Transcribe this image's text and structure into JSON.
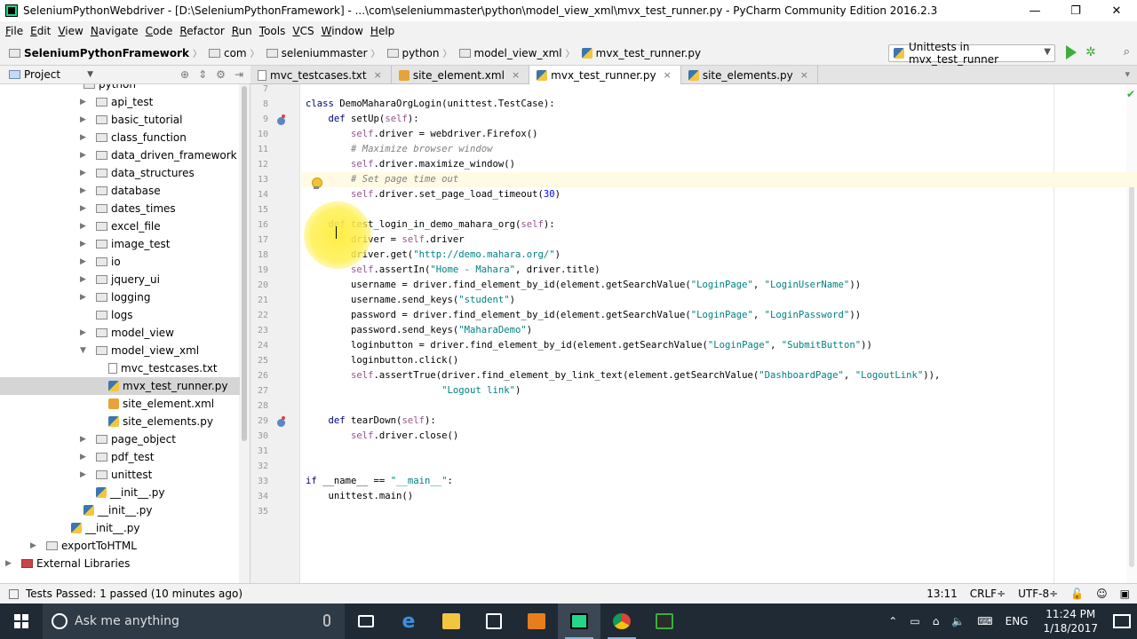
{
  "window": {
    "title": "SeleniumPythonWebdriver - [D:\\SeleniumPythonFramework] - ...\\com\\seleniummaster\\python\\model_view_xml\\mvx_test_runner.py - PyCharm Community Edition 2016.2.3",
    "minimize": "—",
    "maximize": "❐",
    "close": "✕"
  },
  "menu": [
    "File",
    "Edit",
    "View",
    "Navigate",
    "Code",
    "Refactor",
    "Run",
    "Tools",
    "VCS",
    "Window",
    "Help"
  ],
  "breadcrumb": [
    "SeleniumPythonFramework",
    "com",
    "seleniummaster",
    "python",
    "model_view_xml",
    "mvx_test_runner.py"
  ],
  "run_config": "Unittests in mvx_test_runner",
  "project_panel": {
    "label": "Project"
  },
  "tree": [
    {
      "label": "python",
      "indent": 5,
      "icon": "folder",
      "tw": "",
      "y": -10
    },
    {
      "label": "api_test",
      "indent": 6,
      "icon": "folder",
      "tw": "▶"
    },
    {
      "label": "basic_tutorial",
      "indent": 6,
      "icon": "folder",
      "tw": "▶"
    },
    {
      "label": "class_function",
      "indent": 6,
      "icon": "folder",
      "tw": "▶"
    },
    {
      "label": "data_driven_framework",
      "indent": 6,
      "icon": "folder",
      "tw": "▶"
    },
    {
      "label": "data_structures",
      "indent": 6,
      "icon": "folder",
      "tw": "▶"
    },
    {
      "label": "database",
      "indent": 6,
      "icon": "folder",
      "tw": "▶"
    },
    {
      "label": "dates_times",
      "indent": 6,
      "icon": "folder",
      "tw": "▶"
    },
    {
      "label": "excel_file",
      "indent": 6,
      "icon": "folder",
      "tw": "▶"
    },
    {
      "label": "image_test",
      "indent": 6,
      "icon": "folder",
      "tw": "▶"
    },
    {
      "label": "io",
      "indent": 6,
      "icon": "folder",
      "tw": "▶"
    },
    {
      "label": "jquery_ui",
      "indent": 6,
      "icon": "folder",
      "tw": "▶"
    },
    {
      "label": "logging",
      "indent": 6,
      "icon": "folder",
      "tw": "▶"
    },
    {
      "label": "logs",
      "indent": 6,
      "icon": "folder",
      "tw": ""
    },
    {
      "label": "model_view",
      "indent": 6,
      "icon": "folder",
      "tw": "▶"
    },
    {
      "label": "model_view_xml",
      "indent": 6,
      "icon": "folder",
      "tw": "▼"
    },
    {
      "label": "mvc_testcases.txt",
      "indent": 7,
      "icon": "txt",
      "tw": ""
    },
    {
      "label": "mvx_test_runner.py",
      "indent": 7,
      "icon": "py",
      "tw": "",
      "selected": true
    },
    {
      "label": "site_element.xml",
      "indent": 7,
      "icon": "xml",
      "tw": ""
    },
    {
      "label": "site_elements.py",
      "indent": 7,
      "icon": "py",
      "tw": ""
    },
    {
      "label": "page_object",
      "indent": 6,
      "icon": "folder",
      "tw": "▶"
    },
    {
      "label": "pdf_test",
      "indent": 6,
      "icon": "folder",
      "tw": "▶"
    },
    {
      "label": "unittest",
      "indent": 6,
      "icon": "folder",
      "tw": "▶"
    },
    {
      "label": "__init__.py",
      "indent": 6,
      "icon": "py",
      "tw": ""
    },
    {
      "label": "__init__.py",
      "indent": 5,
      "icon": "py",
      "tw": ""
    },
    {
      "label": "__init__.py",
      "indent": 4,
      "icon": "py",
      "tw": ""
    },
    {
      "label": "exportToHTML",
      "indent": 2,
      "icon": "folder",
      "tw": "▶"
    },
    {
      "label": "External Libraries",
      "indent": 0,
      "icon": "lib",
      "tw": "▶"
    }
  ],
  "tabs": [
    {
      "label": "mvc_testcases.txt",
      "icon": "txt"
    },
    {
      "label": "site_element.xml",
      "icon": "xml"
    },
    {
      "label": "mvx_test_runner.py",
      "icon": "py",
      "active": true
    },
    {
      "label": "site_elements.py",
      "icon": "py"
    }
  ],
  "editor": {
    "current_line": 13,
    "lines": [
      {
        "n": "7",
        "html": ""
      },
      {
        "n": "8",
        "html": "<span class='kw'>class</span> DemoMaharaOrgLogin(unittest.TestCase):"
      },
      {
        "n": "9",
        "html": "    <span class='kw'>def</span> setUp(<span class='self'>self</span>):"
      },
      {
        "n": "10",
        "html": "        <span class='self'>self</span>.driver = webdriver.Firefox()"
      },
      {
        "n": "11",
        "html": "        <span class='cmt'># Maximize browser window</span>"
      },
      {
        "n": "12",
        "html": "        <span class='self'>self</span>.driver.maximize_window()"
      },
      {
        "n": "13",
        "html": "        <span class='cmt'># Set page time out</span>"
      },
      {
        "n": "14",
        "html": "        <span class='self'>self</span>.driver.set_page_load_timeout(<span class='num'>30</span>)"
      },
      {
        "n": "15",
        "html": ""
      },
      {
        "n": "16",
        "html": "    <span class='kw'>def</span> test_login_in_demo_mahara_org(<span class='self'>self</span>):"
      },
      {
        "n": "17",
        "html": "        driver = <span class='self'>self</span>.driver"
      },
      {
        "n": "18",
        "html": "        driver.get(<span class='str'>\"http://demo.mahara.org/\"</span>)"
      },
      {
        "n": "19",
        "html": "        <span class='self'>self</span>.assertIn(<span class='str'>\"Home - Mahara\"</span>, driver.title)"
      },
      {
        "n": "20",
        "html": "        username = driver.find_element_by_id(element.getSearchValue(<span class='str'>\"LoginPage\"</span>, <span class='str'>\"LoginUserName\"</span>))"
      },
      {
        "n": "21",
        "html": "        username.send_keys(<span class='str'>\"student\"</span>)"
      },
      {
        "n": "22",
        "html": "        password = driver.find_element_by_id(element.getSearchValue(<span class='str'>\"LoginPage\"</span>, <span class='str'>\"LoginPassword\"</span>))"
      },
      {
        "n": "23",
        "html": "        password.send_keys(<span class='str'>\"MaharaDemo\"</span>)"
      },
      {
        "n": "24",
        "html": "        loginbutton = driver.find_element_by_id(element.getSearchValue(<span class='str'>\"LoginPage\"</span>, <span class='str'>\"SubmitButton\"</span>))"
      },
      {
        "n": "25",
        "html": "        loginbutton.click()"
      },
      {
        "n": "26",
        "html": "        <span class='self'>self</span>.assertTrue(driver.find_element_by_link_text(element.getSearchValue(<span class='str'>\"DashboardPage\"</span>, <span class='str'>\"LogoutLink\"</span>)),"
      },
      {
        "n": "27",
        "html": "                        <span class='str'>\"Logout link\"</span>)"
      },
      {
        "n": "28",
        "html": ""
      },
      {
        "n": "29",
        "html": "    <span class='kw'>def</span> tearDown(<span class='self'>self</span>):"
      },
      {
        "n": "30",
        "html": "        <span class='self'>self</span>.driver.close()"
      },
      {
        "n": "31",
        "html": ""
      },
      {
        "n": "32",
        "html": ""
      },
      {
        "n": "33",
        "html": "<span class='kw'>if</span> __name__ == <span class='str'>\"__main__\"</span>:"
      },
      {
        "n": "34",
        "html": "    unittest.main()"
      },
      {
        "n": "35",
        "html": ""
      }
    ]
  },
  "status": {
    "message": "Tests Passed: 1 passed (10 minutes ago)",
    "position": "13:11",
    "line_sep": "CRLF÷",
    "encoding": "UTF-8÷"
  },
  "taskbar": {
    "search_placeholder": "Ask me anything",
    "lang": "ENG",
    "time": "11:24 PM",
    "date": "1/18/2017"
  }
}
